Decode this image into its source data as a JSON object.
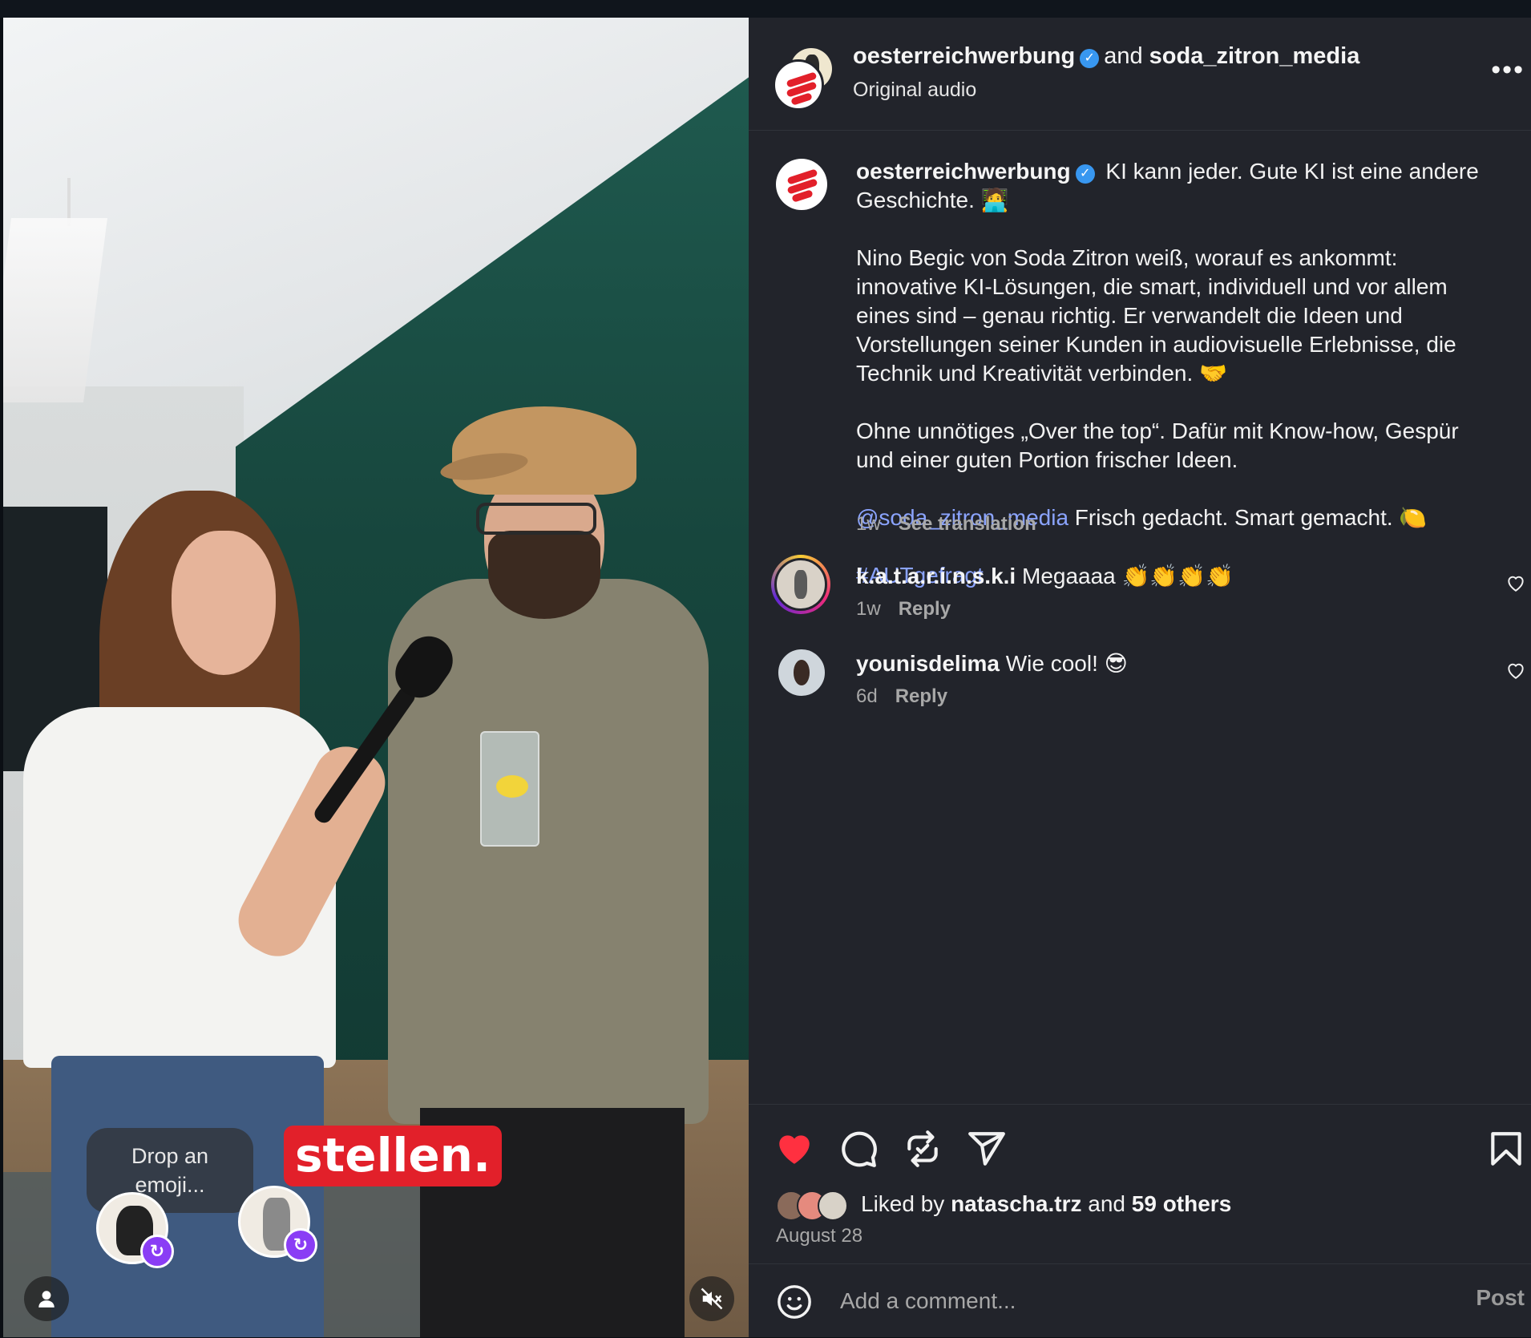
{
  "video": {
    "emoji_prompt": "Drop an emoji...",
    "overlay_caption": "stellen."
  },
  "header": {
    "username": "oesterreichwerbung",
    "connector": "and",
    "collaborator": "soda_zitron_media",
    "subtitle": "Original audio",
    "more_icon": "more-options-icon"
  },
  "caption": {
    "username": "oesterreichwerbung",
    "intro": "KI kann jeder. Gute KI ist eine andere Geschichte. 🧑‍💻",
    "paragraph2": "Nino Begic von Soda Zitron weiß, worauf es ankommt: innovative KI-Lösungen, die smart, individuell und vor allem eines sind – genau richtig. Er verwandelt die Ideen und Vorstellungen seiner Kunden in audiovisuelle Erlebnisse, die Technik und Kreativität verbinden. 🤝",
    "paragraph3": "Ohne unnötiges „Over the top“. Dafür mit Know-how, Gespür und einer guten Portion frischer Ideen.",
    "mention": "@soda_zitron_media",
    "mention_text": "Frisch gedacht. Smart gemacht. 🍋",
    "hashtag": "#AUTgefragt",
    "time": "1w",
    "see_translation": "See translation"
  },
  "comments": [
    {
      "username": "k.a.t.a.r.i.n.s.k.i",
      "text": "Megaaaa 👏👏👏👏",
      "time": "1w",
      "reply": "Reply"
    },
    {
      "username": "younisdelima",
      "text": "Wie cool! 😎",
      "time": "6d",
      "reply": "Reply"
    }
  ],
  "actions": {
    "liked_prefix": "Liked by",
    "liked_user": "natascha.trz",
    "liked_and": "and",
    "liked_others": "59 others",
    "date": "August 28",
    "comment_placeholder": "Add a comment...",
    "post_label": "Post",
    "like_color": "#ff3040"
  },
  "icons": [
    "like-icon",
    "comment-icon",
    "repost-icon",
    "share-icon",
    "bookmark-icon",
    "emoji-icon",
    "mute-icon",
    "user-icon"
  ]
}
